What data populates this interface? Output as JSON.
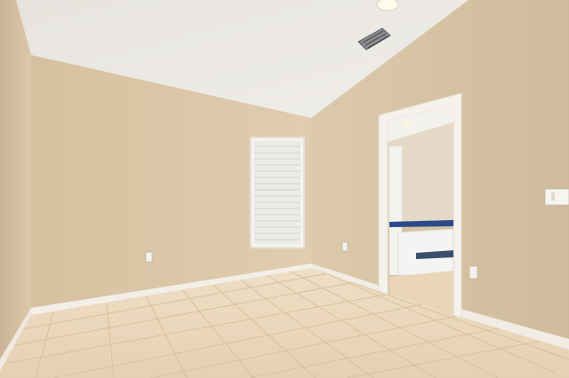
{
  "scene": {
    "description_visible_text": "",
    "colors": {
      "ceiling": "#ebe8e3",
      "wall_left": "#d9c5a6",
      "wall_back": "#dcc8a8",
      "wall_right": "#d6c3a4",
      "floor": "#ead6ba",
      "grout": "#d8c2a2",
      "baseboard": "#f3efe8",
      "trim": "#f5f2ec",
      "window_blind": "#f2f1ee",
      "bathroom_wall": "#e6dccb",
      "tub": "#f4f4f2",
      "tile_accent": "#2a4a8a"
    },
    "icons": [
      "ceiling-light-icon",
      "air-vent-icon",
      "outlet-icon",
      "light-switch-icon"
    ]
  }
}
